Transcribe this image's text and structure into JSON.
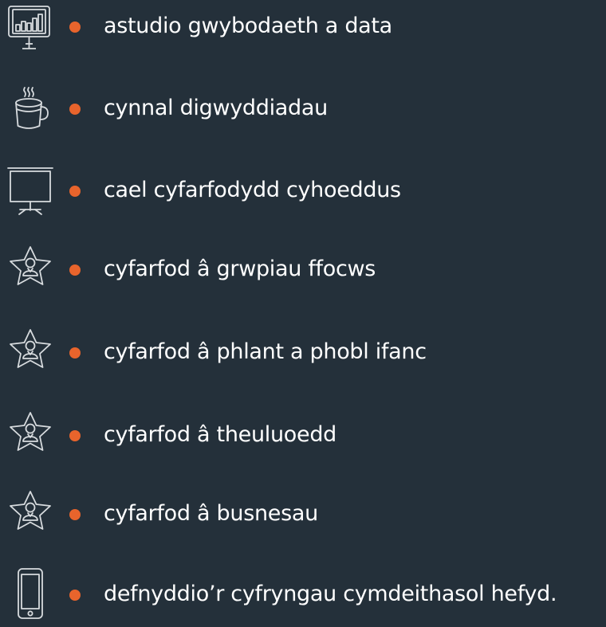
{
  "colors": {
    "background": "#24303a",
    "bullet": "#e8642c",
    "icon": "#d7dbde",
    "text": "#ffffff"
  },
  "items": [
    {
      "icon": "analytics-monitor-icon",
      "label": "astudio gwybodaeth a data"
    },
    {
      "icon": "coffee-cup-icon",
      "label": "cynnal digwyddiadau"
    },
    {
      "icon": "presentation-screen-icon",
      "label": "cael cyfarfodydd cyhoeddus"
    },
    {
      "icon": "star-person-icon",
      "label": "cyfarfod â grwpiau ffocws"
    },
    {
      "icon": "star-person-icon",
      "label": "cyfarfod â phlant a phobl ifanc"
    },
    {
      "icon": "star-person-icon",
      "label": "cyfarfod â theuluoedd"
    },
    {
      "icon": "star-person-icon",
      "label": "cyfarfod â busnesau"
    },
    {
      "icon": "mobile-phone-icon",
      "label": "defnyddio’r cyfryngau cymdeithasol hefyd."
    }
  ]
}
